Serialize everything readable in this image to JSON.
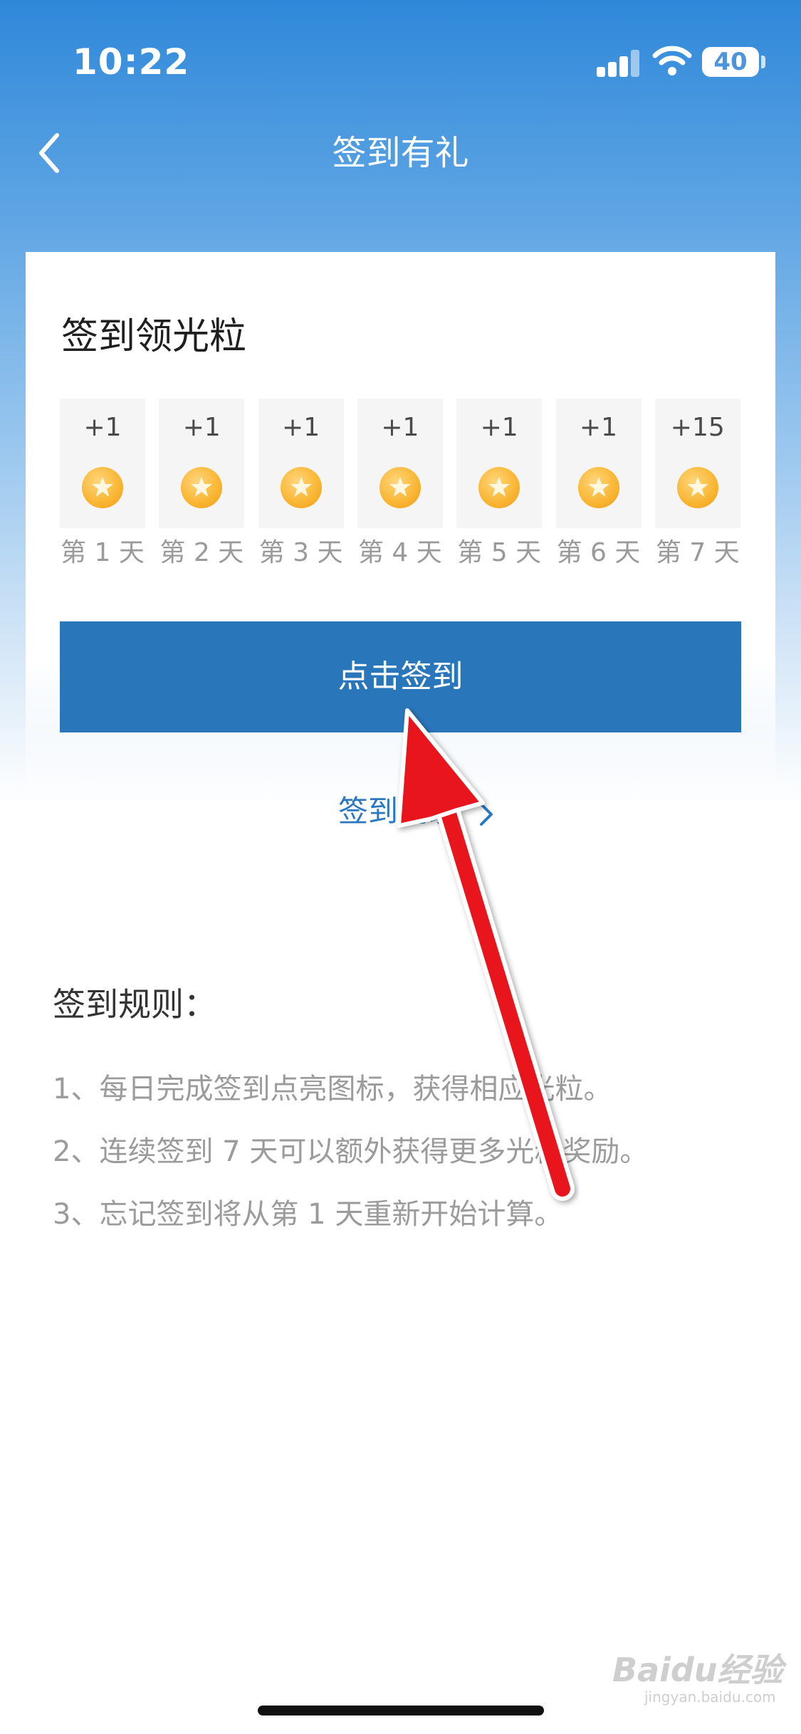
{
  "status_bar": {
    "time": "10:22",
    "battery": "40"
  },
  "nav": {
    "title": "签到有礼"
  },
  "card": {
    "title": "签到领光粒",
    "days": [
      {
        "reward": "+1",
        "label": "第 1 天"
      },
      {
        "reward": "+1",
        "label": "第 2 天"
      },
      {
        "reward": "+1",
        "label": "第 3 天"
      },
      {
        "reward": "+1",
        "label": "第 4 天"
      },
      {
        "reward": "+1",
        "label": "第 5 天"
      },
      {
        "reward": "+1",
        "label": "第 6 天"
      },
      {
        "reward": "+15",
        "label": "第 7 天"
      }
    ],
    "sign_in_button": "点击签到",
    "record_link": "签到记录"
  },
  "rules": {
    "title": "签到规则：",
    "items": [
      "1、每日完成签到点亮图标，获得相应光粒。",
      "2、连续签到 7 天可以额外获得更多光粒奖励。",
      "3、忘记签到将从第 1 天重新开始计算。"
    ]
  },
  "watermark": {
    "brand": "Baidu经验",
    "url": "jingyan.baidu.com"
  },
  "colors": {
    "primary_button": "#2a76bb",
    "link": "#2b78c2",
    "coin": "#f9b531",
    "annotation_arrow": "#e8141c"
  },
  "icons": {
    "back": "chevron-left-icon",
    "coin": "star-coin-icon",
    "record": "chevron-right-icon"
  }
}
